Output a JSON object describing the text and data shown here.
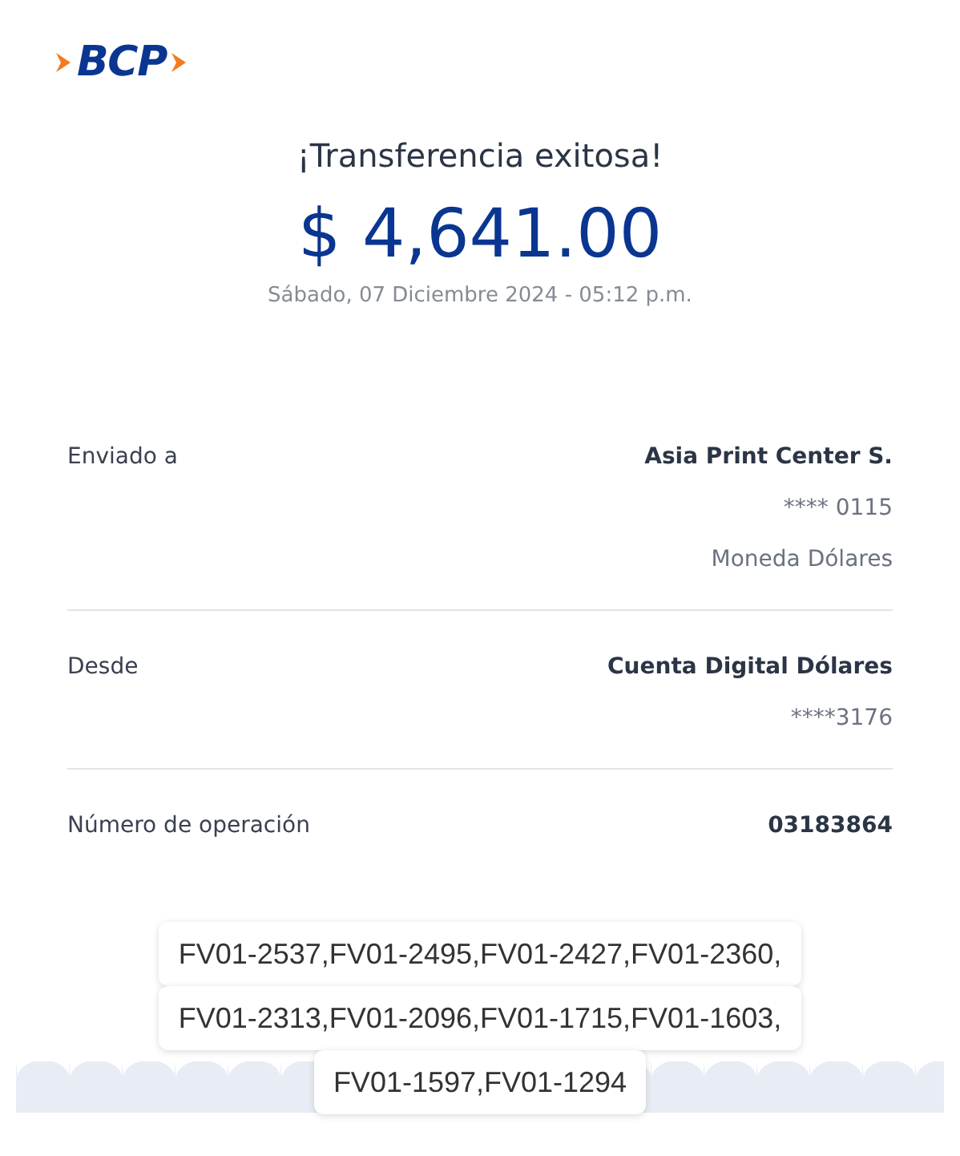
{
  "logo": {
    "text": "BCP"
  },
  "title": "¡Transferencia exitosa!",
  "amount": "$ 4,641.00",
  "date": "Sábado, 07 Diciembre 2024 - 05:12 p.m.",
  "sections": [
    {
      "label": "Enviado a",
      "values": [
        {
          "text": "Asia Print Center S.",
          "kind": "primary"
        },
        {
          "text": "**** 0115",
          "kind": "secondary"
        },
        {
          "text": "Moneda Dólares",
          "kind": "secondary"
        }
      ]
    },
    {
      "label": "Desde",
      "values": [
        {
          "text": "Cuenta Digital Dólares",
          "kind": "primary"
        },
        {
          "text": "****3176",
          "kind": "secondary"
        }
      ]
    },
    {
      "label": "Número de operación",
      "values": [
        {
          "text": "03183864",
          "kind": "primary"
        }
      ]
    }
  ],
  "note_lines": [
    "FV01-2537,FV01-2495,FV01-2427,FV01-2360,",
    "FV01-2313,FV01-2096,FV01-1715,FV01-1603,",
    "FV01-1597,FV01-1294"
  ]
}
